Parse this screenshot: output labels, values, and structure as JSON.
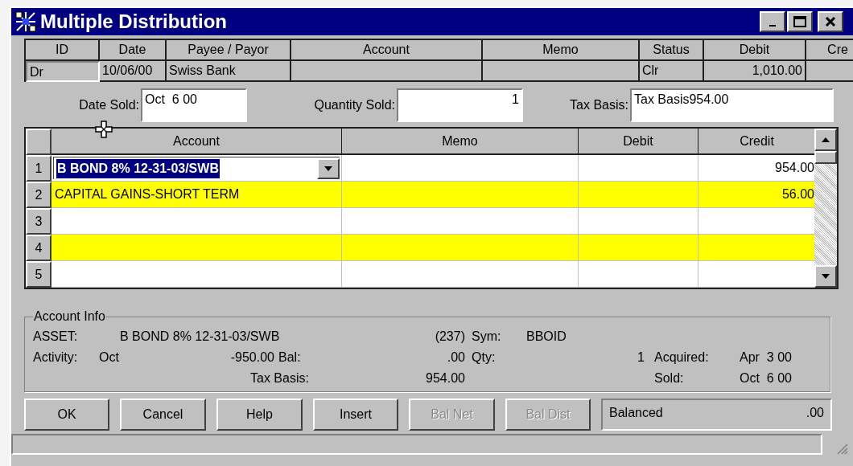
{
  "window": {
    "title": "Multiple Distribution"
  },
  "transaction": {
    "columns": [
      {
        "label": "ID",
        "kind": "text"
      },
      {
        "label": "Date",
        "kind": "text"
      },
      {
        "label": "Payee / Payor",
        "kind": "text"
      },
      {
        "label": "Account",
        "kind": "text"
      },
      {
        "label": "Memo",
        "kind": "text"
      },
      {
        "label": "Status",
        "kind": "text"
      },
      {
        "label": "Debit",
        "kind": "amount"
      },
      {
        "label": "Cre",
        "kind": "text"
      }
    ],
    "cells": [
      {
        "text": "Dr"
      },
      {
        "text": "10/06/00"
      },
      {
        "text": "Swiss Bank"
      },
      {},
      {},
      {
        "text": "Clr"
      },
      {
        "text": "1,010.00"
      },
      {}
    ]
  },
  "fields": [
    {
      "label": "Date Sold:",
      "value": "Oct  6 00",
      "kind": "text"
    },
    {
      "label": "Quantity Sold:",
      "value": "1",
      "kind": "number"
    },
    {
      "label": "Tax Basis:",
      "value": "Tax Basis954.00",
      "kind": "text"
    }
  ],
  "grid": {
    "columns": [
      {
        "label": "Account"
      },
      {
        "label": "Memo"
      },
      {
        "label": "Debit"
      },
      {
        "label": "Credit"
      }
    ],
    "rows": [
      {
        "number": "1",
        "account": "B BOND 8% 12-31-03/SWB",
        "credit": "954.00",
        "highlighted": false,
        "editing": true
      },
      {
        "number": "2",
        "account": "CAPITAL GAINS-SHORT TERM",
        "credit": "56.00",
        "highlighted": true,
        "editing": false
      },
      {
        "number": "3",
        "highlighted": false,
        "editing": false
      },
      {
        "number": "4",
        "highlighted": true,
        "editing": false
      },
      {
        "number": "5",
        "highlighted": false,
        "editing": false
      }
    ]
  },
  "account_info": {
    "title": "Account Info",
    "asset_label": "ASSET:",
    "asset": "B BOND 8% 12-31-03/SWB",
    "asset_number": "(237)",
    "sym_label": "Sym:",
    "sym": "BBOID",
    "activity_label": "Activity:",
    "activity_month": "Oct",
    "activity_amount": "-950.00",
    "bal_label": "Bal:",
    "bal": ".00",
    "qty_label": "Qty:",
    "qty": "1",
    "acquired_label": "Acquired:",
    "acquired": "Apr  3 00",
    "tax_basis_label": "Tax Basis:",
    "tax_basis": "954.00",
    "sold_label": "Sold:",
    "sold": "Oct  6 00"
  },
  "buttons": [
    {
      "label": "OK",
      "disabled": false
    },
    {
      "label": "Cancel",
      "disabled": false
    },
    {
      "label": "Help",
      "disabled": false
    },
    {
      "label": "Insert",
      "disabled": false
    },
    {
      "label": "Bal Net",
      "disabled": true
    },
    {
      "label": "Bal Dist",
      "disabled": true
    }
  ],
  "balance": {
    "label": "Balanced",
    "amount": ".00"
  }
}
